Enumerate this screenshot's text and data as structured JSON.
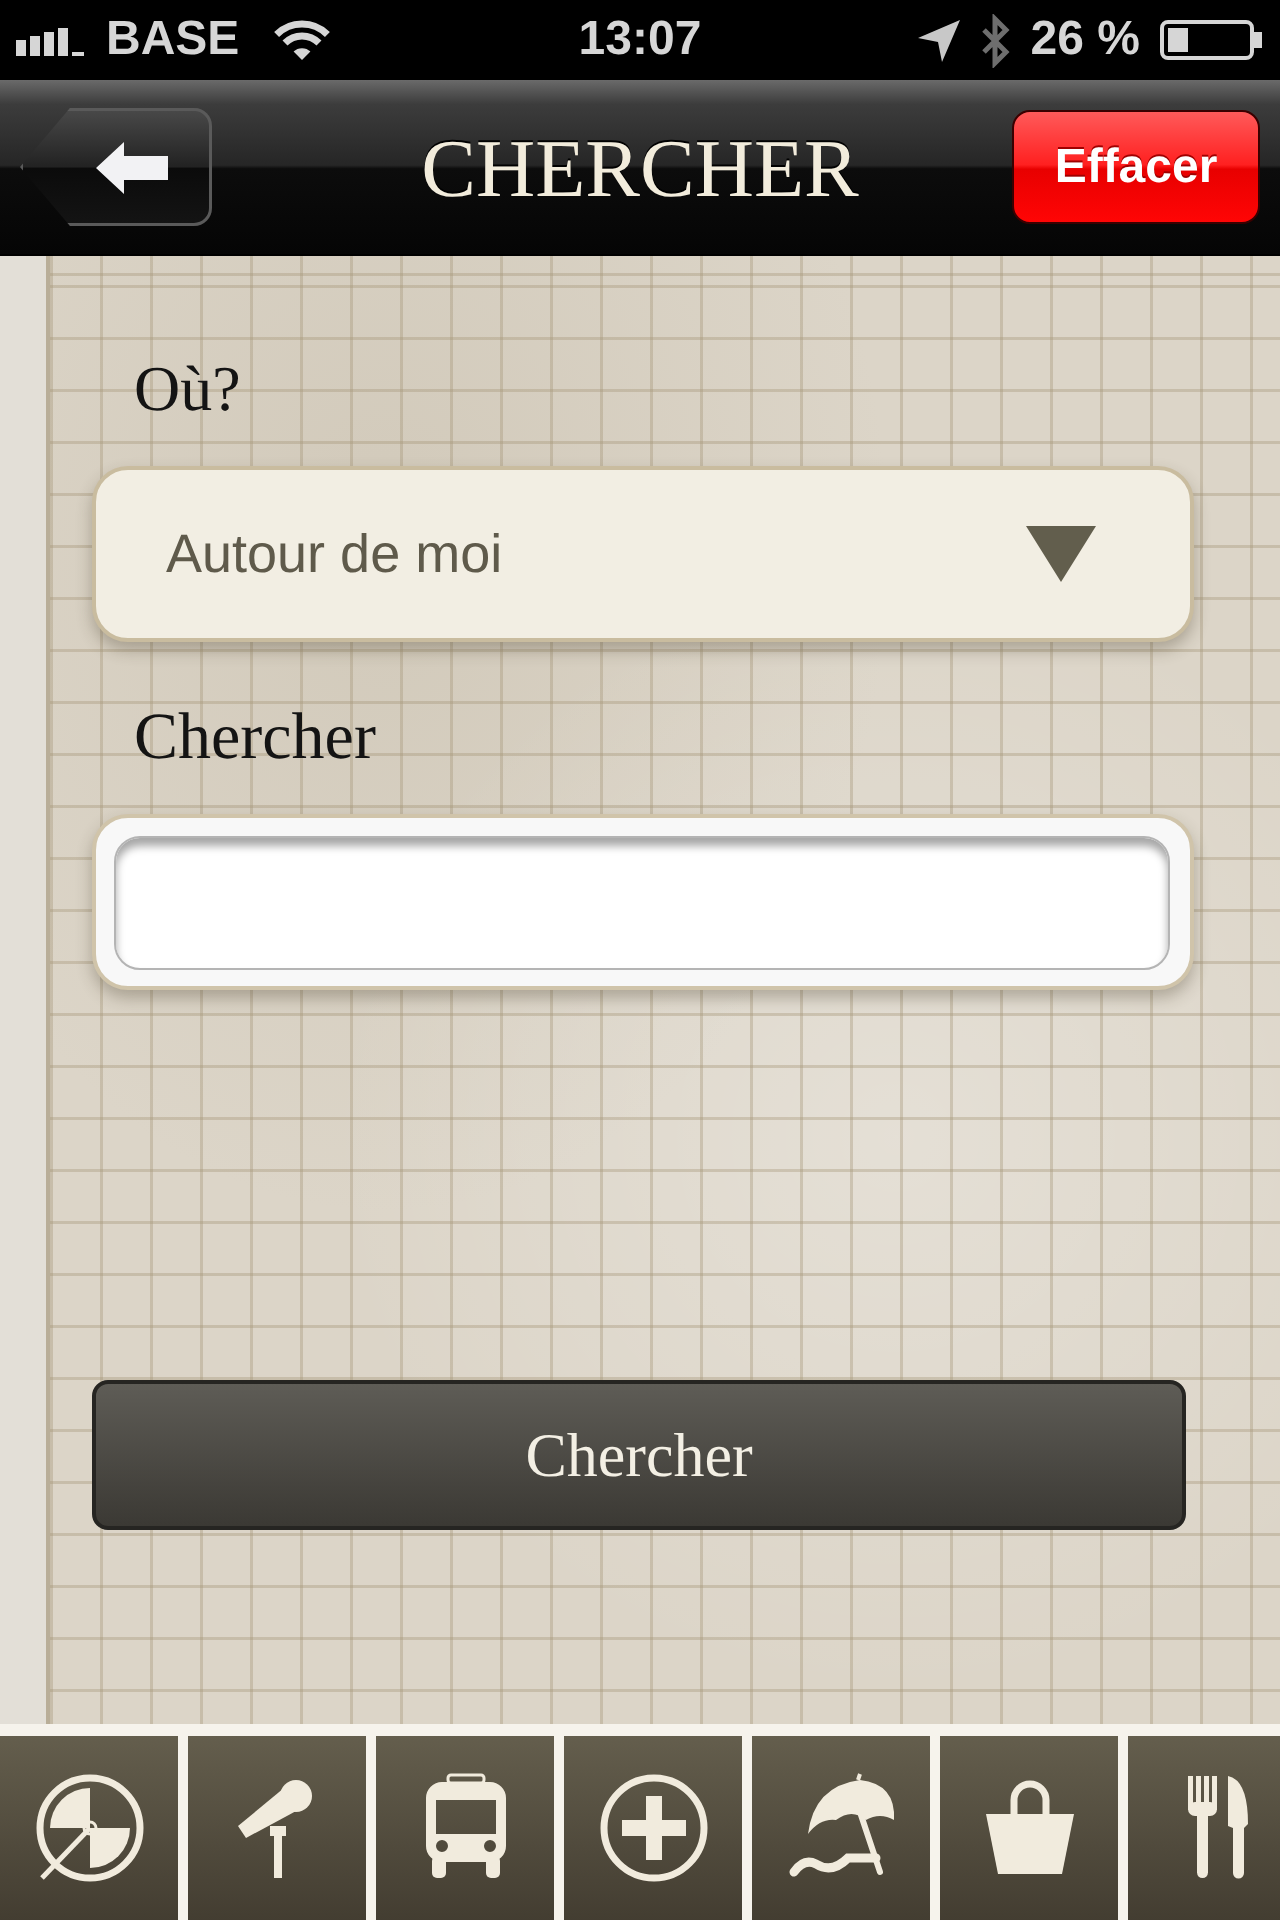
{
  "status_bar": {
    "carrier": "BASE",
    "time": "13:07",
    "battery_percent": "26 %"
  },
  "nav_bar": {
    "title": "CHERCHER",
    "clear_button": "Effacer"
  },
  "form": {
    "location_label": "Où?",
    "location_select": {
      "value": "Autour de moi"
    },
    "search_label": "Chercher",
    "search_button": "Chercher"
  }
}
